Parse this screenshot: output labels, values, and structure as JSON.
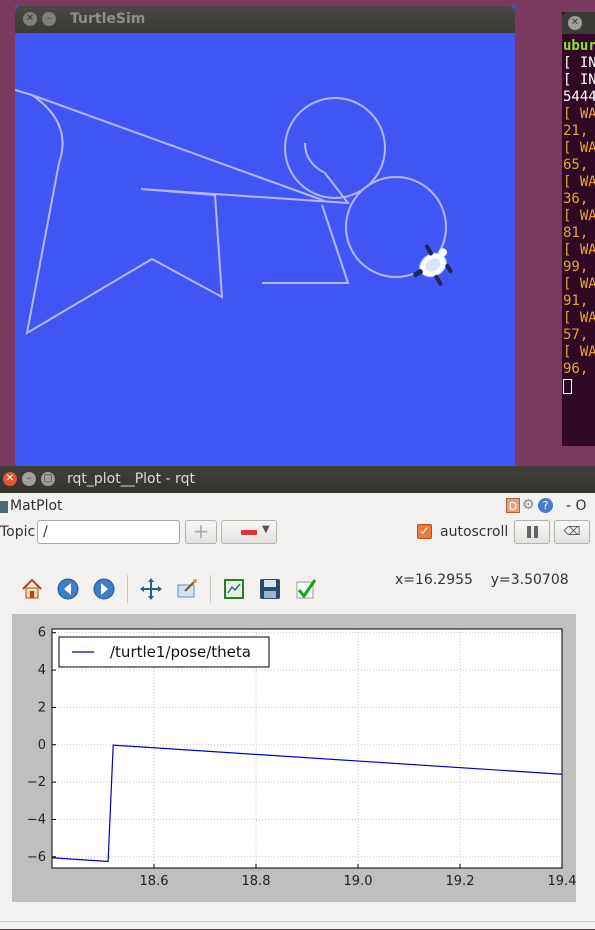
{
  "turtlesim": {
    "title": "TurtleSim",
    "colors": {
      "background": "#4056f4",
      "path": "#b3b8ff"
    }
  },
  "terminal": {
    "lines": [
      {
        "text": "ubur",
        "color": "#8ae234",
        "bold": true
      },
      {
        "text": "[ IN",
        "color": "#ffffff"
      },
      {
        "text": "[ IN",
        "color": "#ffffff"
      },
      {
        "text": "5444",
        "color": "#ffffff"
      },
      {
        "text": "[ WA",
        "color": "#e6a23c"
      },
      {
        "text": "21,",
        "color": "#e6a23c"
      },
      {
        "text": "[ WA",
        "color": "#e6a23c"
      },
      {
        "text": "65,",
        "color": "#e6a23c"
      },
      {
        "text": "[ WA",
        "color": "#e6a23c"
      },
      {
        "text": "36,",
        "color": "#e6a23c"
      },
      {
        "text": "[ WA",
        "color": "#e6a23c"
      },
      {
        "text": "81,",
        "color": "#e6a23c"
      },
      {
        "text": "[ WA",
        "color": "#e6a23c"
      },
      {
        "text": "99,",
        "color": "#e6a23c"
      },
      {
        "text": "[ WA",
        "color": "#e6a23c"
      },
      {
        "text": "91,",
        "color": "#e6a23c"
      },
      {
        "text": "[ WA",
        "color": "#e6a23c"
      },
      {
        "text": "57,",
        "color": "#e6a23c"
      },
      {
        "text": "[ WA",
        "color": "#e6a23c"
      },
      {
        "text": "96,",
        "color": "#e6a23c"
      }
    ]
  },
  "rqt": {
    "title": "rqt_plot__Plot - rqt",
    "plugin_label": "MatPlot",
    "d_label": "D",
    "help_label": "?",
    "minimize_label": "- O",
    "topic_label": "Topic",
    "topic_value": "/",
    "add_label": "+",
    "autoscroll_label": "autoscroll",
    "autoscroll_checked": true,
    "clear_label": "⌫",
    "toolbar_icons": [
      "home-icon",
      "back-icon",
      "forward-icon",
      "pan-icon",
      "zoom-icon",
      "subplots-icon",
      "save-icon",
      "apply-icon"
    ],
    "coords": {
      "x": "x=16.2955",
      "y": "y=3.50708"
    }
  },
  "chart_data": {
    "type": "line",
    "title": "",
    "xlabel": "",
    "ylabel": "",
    "xlim": [
      18.4,
      19.4
    ],
    "ylim": [
      -6.6,
      6.2
    ],
    "xticks": [
      18.6,
      18.8,
      19.0,
      19.2,
      19.4
    ],
    "xtick_labels": [
      "18.6",
      "18.8",
      "19.0",
      "19.2",
      "19.4"
    ],
    "yticks": [
      6,
      4,
      2,
      0,
      -2,
      -4,
      -6
    ],
    "ytick_labels": [
      "6",
      "4",
      "2",
      "0",
      "−2",
      "−4",
      "−6"
    ],
    "grid": true,
    "legend_position": "top-left",
    "series": [
      {
        "name": "/turtle1/pose/theta",
        "color": "#0000cc",
        "x": [
          18.4,
          18.51,
          18.52,
          19.4
        ],
        "y": [
          -6.05,
          -6.25,
          -0.02,
          -1.58
        ]
      }
    ]
  }
}
